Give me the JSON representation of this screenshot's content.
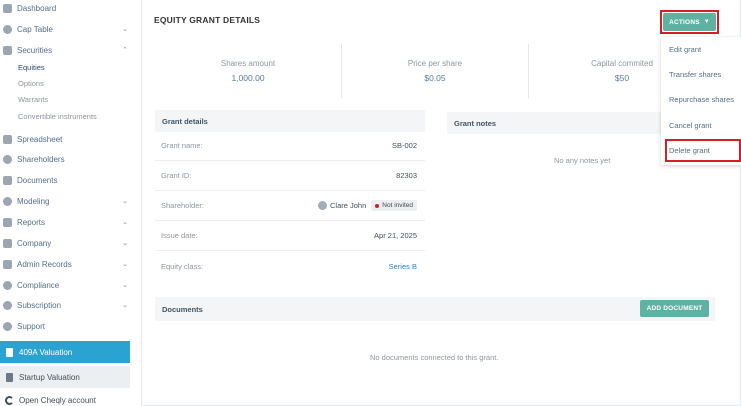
{
  "sidebar": {
    "items": [
      {
        "label": "Dashboard",
        "icon": "dashboard-icon"
      },
      {
        "label": "Cap Table",
        "icon": "pie-chart-icon",
        "chevron": "down"
      },
      {
        "label": "Securities",
        "icon": "document-icon",
        "chevron": "up"
      },
      {
        "label": "Spreadsheet",
        "icon": "spreadsheet-icon"
      },
      {
        "label": "Shareholders",
        "icon": "user-icon"
      },
      {
        "label": "Documents",
        "icon": "folder-icon"
      },
      {
        "label": "Modeling",
        "icon": "lightbulb-icon",
        "chevron": "down"
      },
      {
        "label": "Reports",
        "icon": "report-icon",
        "chevron": "down"
      },
      {
        "label": "Company",
        "icon": "building-icon",
        "chevron": "down"
      },
      {
        "label": "Admin Records",
        "icon": "records-icon",
        "chevron": "down"
      },
      {
        "label": "Compliance",
        "icon": "shield-icon",
        "chevron": "down"
      },
      {
        "label": "Subscription",
        "icon": "subscription-icon",
        "chevron": "down"
      },
      {
        "label": "Support",
        "icon": "support-icon"
      }
    ],
    "securities_sub": [
      "Equities",
      "Options",
      "Warrants",
      "Convertible instruments"
    ],
    "valuation_primary": "409A Valuation",
    "valuation_secondary": "Startup Valuation",
    "cheqly": "Open Cheqly account",
    "accent": "#2ba3d2"
  },
  "header": {
    "title": "EQUITY GRANT DETAILS",
    "actions_label": "ACTIONS"
  },
  "stats": [
    {
      "label": "Shares amount",
      "value": "1,000.00"
    },
    {
      "label": "Price per share",
      "value": "$0.05"
    },
    {
      "label": "Capital commited",
      "value": "$50"
    }
  ],
  "grant_details": {
    "heading": "Grant details",
    "rows": [
      {
        "label": "Grant name:",
        "value": "SB-002"
      },
      {
        "label": "Grant ID:",
        "value": "82303"
      },
      {
        "label": "Shareholder:",
        "value": "Clare John",
        "badge": "Not invited"
      },
      {
        "label": "Issue date:",
        "value": "Apr 21, 2025"
      },
      {
        "label": "Equity class:",
        "value": "Series B"
      }
    ]
  },
  "grant_notes": {
    "heading": "Grant notes",
    "empty": "No any notes yet"
  },
  "documents": {
    "heading": "Documents",
    "add_label": "ADD DOCUMENT",
    "empty": "No documents connected to this grant."
  },
  "actions_menu": [
    "Edit grant",
    "Transfer shares",
    "Repurchase shares",
    "Cancel grant",
    "Delete grant"
  ],
  "colors": {
    "button": "#5fb1a2",
    "highlight": "#d1202a"
  }
}
